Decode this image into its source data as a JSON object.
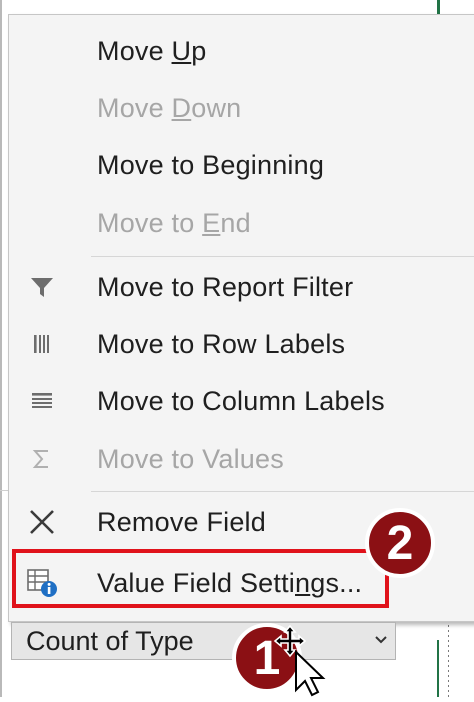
{
  "menu": {
    "items": [
      {
        "pre": "Move ",
        "ul": "U",
        "post": "p",
        "disabled": false,
        "icon": ""
      },
      {
        "pre": "Move ",
        "ul": "D",
        "post": "own",
        "disabled": true,
        "icon": ""
      },
      {
        "pre": "Move to Be",
        "ul": "g",
        "post": "inning",
        "disabled": false,
        "icon": ""
      },
      {
        "pre": "Move to ",
        "ul": "E",
        "post": "nd",
        "disabled": true,
        "icon": ""
      },
      {
        "label": "Move to Report Filter",
        "disabled": false,
        "icon": "funnel-icon"
      },
      {
        "label": "Move to Row Labels",
        "disabled": false,
        "icon": "row-labels-icon"
      },
      {
        "label": "Move to Column Labels",
        "disabled": false,
        "icon": "column-labels-icon"
      },
      {
        "label": "Move to Values",
        "disabled": true,
        "icon": "sigma-icon"
      },
      {
        "label": "Remove Field",
        "disabled": false,
        "icon": "close-x-icon"
      },
      {
        "pre": "Value Field Setti",
        "ul": "n",
        "post": "gs...",
        "disabled": false,
        "icon": "value-field-settings-icon"
      }
    ]
  },
  "field_button": {
    "label": "Count of Type"
  },
  "callouts": {
    "step1": "1",
    "step2": "2"
  },
  "colors": {
    "highlight": "#e0121b",
    "badge": "#8b1014",
    "disabled_text": "#a6a6a6"
  }
}
